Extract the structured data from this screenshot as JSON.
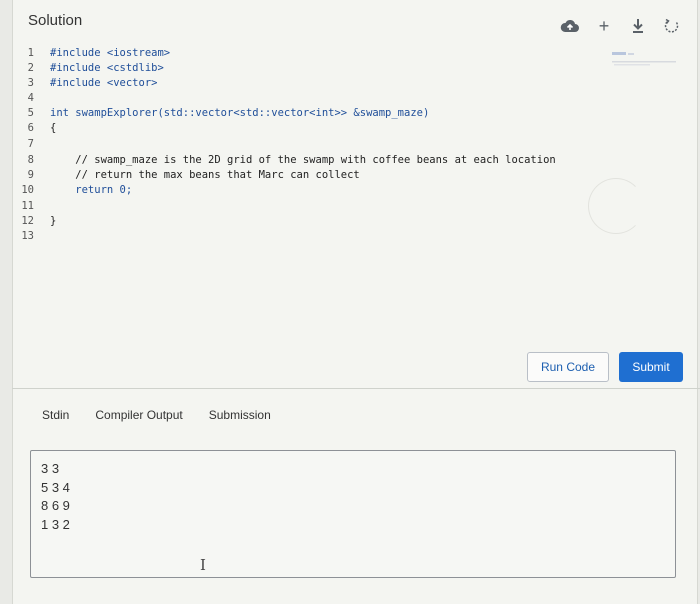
{
  "header": {
    "title": "Solution",
    "toolbar": {
      "cloud_icon": "cloud-upload-icon",
      "plus_label": "+",
      "download_icon": "download-icon",
      "reset_icon": "reset-icon"
    }
  },
  "editor": {
    "lines": [
      {
        "n": "1",
        "text": "#include <iostream>"
      },
      {
        "n": "2",
        "text": "#include <cstdlib>"
      },
      {
        "n": "3",
        "text": "#include <vector>"
      },
      {
        "n": "4",
        "text": ""
      },
      {
        "n": "5",
        "text": "int swampExplorer(std::vector<std::vector<int>> &swamp_maze)"
      },
      {
        "n": "6",
        "text": "{"
      },
      {
        "n": "7",
        "text": ""
      },
      {
        "n": "8",
        "text": "    // swamp_maze is the 2D grid of the swamp with coffee beans at each location"
      },
      {
        "n": "9",
        "text": "    // return the max beans that Marc can collect"
      },
      {
        "n": "10",
        "text": "    return 0;"
      },
      {
        "n": "11",
        "text": ""
      },
      {
        "n": "12",
        "text": "}"
      },
      {
        "n": "13",
        "text": ""
      }
    ]
  },
  "actions": {
    "run_label": "Run Code",
    "submit_label": "Submit"
  },
  "tabs": [
    {
      "label": "Stdin"
    },
    {
      "label": "Compiler Output"
    },
    {
      "label": "Submission"
    }
  ],
  "stdin": {
    "value": "3 3\n5 3 4\n8 6 9\n1 3 2"
  },
  "colors": {
    "submit_bg": "#1f6fd1",
    "run_text": "#1d5fb0",
    "background": "#f4f5f1"
  }
}
